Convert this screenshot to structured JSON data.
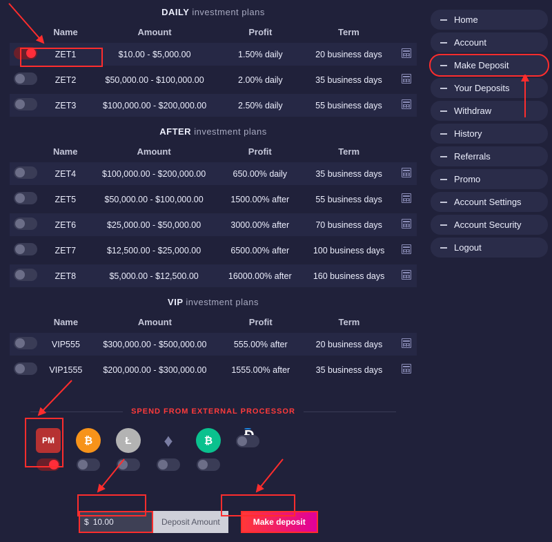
{
  "tables": {
    "daily": {
      "title_bold": "DAILY",
      "title_rest": "investment plans",
      "headers": {
        "name": "Name",
        "amount": "Amount",
        "profit": "Profit",
        "term": "Term"
      },
      "rows": [
        {
          "on": true,
          "name": "ZET1",
          "amount": "$10.00 - $5,000.00",
          "profit": "1.50% daily",
          "term": "20 business days"
        },
        {
          "on": false,
          "name": "ZET2",
          "amount": "$50,000.00 - $100,000.00",
          "profit": "2.00% daily",
          "term": "35 business days"
        },
        {
          "on": false,
          "name": "ZET3",
          "amount": "$100,000.00 - $200,000.00",
          "profit": "2.50% daily",
          "term": "55 business days"
        }
      ]
    },
    "after": {
      "title_bold": "AFTER",
      "title_rest": "investment plans",
      "headers": {
        "name": "Name",
        "amount": "Amount",
        "profit": "Profit",
        "term": "Term"
      },
      "rows": [
        {
          "on": false,
          "name": "ZET4",
          "amount": "$100,000.00 - $200,000.00",
          "profit": "650.00% daily",
          "term": "35 business days"
        },
        {
          "on": false,
          "name": "ZET5",
          "amount": "$50,000.00 - $100,000.00",
          "profit": "1500.00% after",
          "term": "55 business days"
        },
        {
          "on": false,
          "name": "ZET6",
          "amount": "$25,000.00 - $50,000.00",
          "profit": "3000.00% after",
          "term": "70 business days"
        },
        {
          "on": false,
          "name": "ZET7",
          "amount": "$12,500.00 - $25,000.00",
          "profit": "6500.00% after",
          "term": "100 business days"
        },
        {
          "on": false,
          "name": "ZET8",
          "amount": "$5,000.00 - $12,500.00",
          "profit": "16000.00% after",
          "term": "160 business days"
        }
      ]
    },
    "vip": {
      "title_bold": "VIP",
      "title_rest": "investment plans",
      "headers": {
        "name": "Name",
        "amount": "Amount",
        "profit": "Profit",
        "term": "Term"
      },
      "rows": [
        {
          "on": false,
          "name": "VIP555",
          "amount": "$300,000.00 - $500,000.00",
          "profit": "555.00% after",
          "term": "20 business days"
        },
        {
          "on": false,
          "name": "VIP1555",
          "amount": "$200,000.00 - $300,000.00",
          "profit": "1555.00% after",
          "term": "35 business days"
        }
      ]
    }
  },
  "payment": {
    "title": "SPEND FROM EXTERNAL PROCESSOR",
    "processors": [
      {
        "key": "pm",
        "label": "PM",
        "on": true
      },
      {
        "key": "btc",
        "label": "₿",
        "on": false
      },
      {
        "key": "ltc",
        "label": "Ł",
        "on": false
      },
      {
        "key": "eth",
        "label": "♦",
        "on": false
      },
      {
        "key": "bch",
        "label": "₿",
        "on": false
      },
      {
        "key": "dash",
        "label": "Đ",
        "on": false
      }
    ],
    "amount_currency": "$",
    "amount_value": "10.00",
    "amount_label": "Deposit Amount",
    "submit_label": "Make deposit"
  },
  "nav": {
    "items": [
      {
        "label": "Home",
        "active": false
      },
      {
        "label": "Account",
        "active": false
      },
      {
        "label": "Make Deposit",
        "active": true
      },
      {
        "label": "Your Deposits",
        "active": false
      },
      {
        "label": "Withdraw",
        "active": false
      },
      {
        "label": "History",
        "active": false
      },
      {
        "label": "Referrals",
        "active": false
      },
      {
        "label": "Promo",
        "active": false
      },
      {
        "label": "Account Settings",
        "active": false
      },
      {
        "label": "Account Security",
        "active": false
      },
      {
        "label": "Logout",
        "active": false
      }
    ]
  }
}
